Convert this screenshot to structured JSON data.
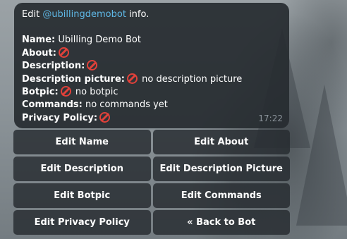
{
  "message": {
    "header_prefix": "Edit ",
    "bot_handle": "@ubillingdemobot",
    "header_suffix": " info.",
    "fields": {
      "name_label": "Name:",
      "name_value": "Ubilling Demo Bot",
      "about_label": "About:",
      "description_label": "Description:",
      "description_picture_label": "Description picture:",
      "description_picture_value": "no description picture",
      "botpic_label": "Botpic:",
      "botpic_value": "no botpic",
      "commands_label": "Commands:",
      "commands_value": "no commands yet",
      "privacy_policy_label": "Privacy Policy:"
    },
    "status_icon": "prohibited-icon",
    "status_color": "#e0413a",
    "time": "17:22"
  },
  "keyboard": {
    "rows": [
      [
        "Edit Name",
        "Edit About"
      ],
      [
        "Edit Description",
        "Edit Description Picture"
      ],
      [
        "Edit Botpic",
        "Edit Commands"
      ],
      [
        "Edit Privacy Policy",
        "« Back to Bot"
      ]
    ]
  },
  "colors": {
    "mention": "#5fb8e6",
    "bubble_bg": "#262b30"
  }
}
